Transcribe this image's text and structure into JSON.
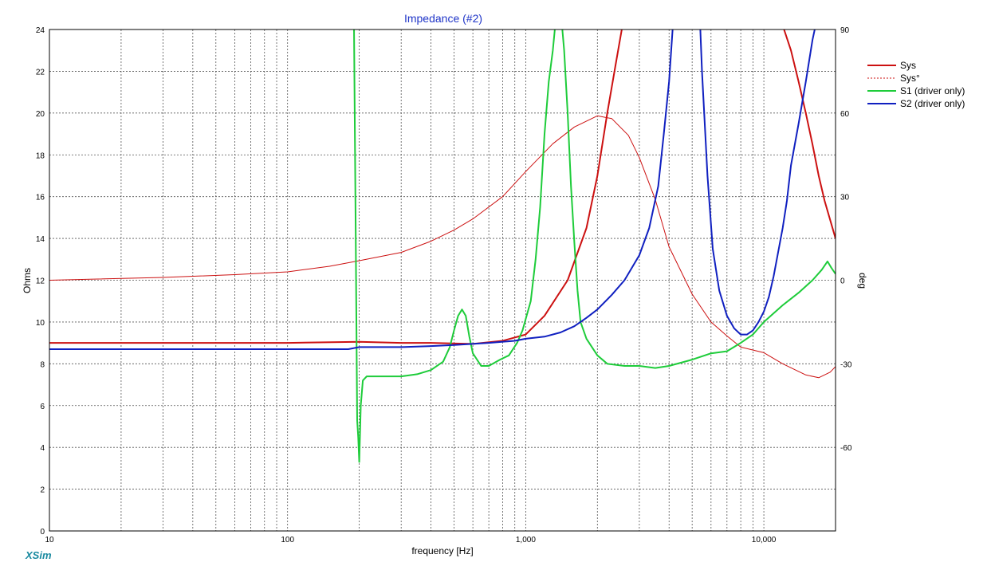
{
  "app": {
    "brand": "XSim"
  },
  "colors": {
    "sys": "#cc1111",
    "sys_phase": "#cc1111",
    "s1": "#1ecc3a",
    "s2": "#1020c0",
    "title": "#1f35c8",
    "brand": "#1a8aa0"
  },
  "chart_data": {
    "type": "line",
    "title": "Impedance (#2)",
    "xlabel": "frequency [Hz]",
    "ylabel": "Ohms",
    "y2label": "deg",
    "xscale": "log",
    "xlim": [
      10,
      20000
    ],
    "ylim": [
      0,
      24
    ],
    "y2lim": [
      -90,
      90
    ],
    "grid": true,
    "legend_position": "right",
    "x_tick_labels": [
      {
        "value": 10,
        "label": "10"
      },
      {
        "value": 100,
        "label": "100"
      },
      {
        "value": 1000,
        "label": "1,000"
      },
      {
        "value": 10000,
        "label": "10,000"
      }
    ],
    "y_ticks": [
      "0",
      "2",
      "4",
      "6",
      "8",
      "10",
      "12",
      "14",
      "16",
      "18",
      "20",
      "22",
      "24"
    ],
    "y2_ticks": [
      "90",
      "60",
      "30",
      "0",
      "-30",
      "-60"
    ],
    "series": [
      {
        "name": "Sys",
        "axis": "left",
        "style": "solid",
        "width": 2,
        "points": [
          [
            10,
            9.0
          ],
          [
            100,
            9.0
          ],
          [
            200,
            9.05
          ],
          [
            300,
            9.0
          ],
          [
            400,
            9.0
          ],
          [
            600,
            8.95
          ],
          [
            800,
            9.1
          ],
          [
            1000,
            9.4
          ],
          [
            1200,
            10.3
          ],
          [
            1500,
            12.0
          ],
          [
            1800,
            14.5
          ],
          [
            2000,
            17.0
          ],
          [
            2200,
            20.0
          ],
          [
            2400,
            22.5
          ],
          [
            2550,
            24.2
          ]
        ]
      },
      {
        "name": "Sys",
        "axis": "left",
        "style": "solid",
        "width": 2,
        "legend": false,
        "points": [
          [
            12000,
            24.2
          ],
          [
            13000,
            23.0
          ],
          [
            14000,
            21.5
          ],
          [
            15000,
            20.0
          ],
          [
            16000,
            18.5
          ],
          [
            17000,
            17.0
          ],
          [
            18000,
            15.8
          ],
          [
            20000,
            14.0
          ]
        ]
      },
      {
        "name": "Sys°",
        "axis": "right",
        "style": "thin",
        "width": 1,
        "points": [
          [
            10,
            0
          ],
          [
            30,
            1
          ],
          [
            60,
            2
          ],
          [
            100,
            3
          ],
          [
            150,
            5
          ],
          [
            200,
            7
          ],
          [
            300,
            10
          ],
          [
            400,
            14
          ],
          [
            500,
            18
          ],
          [
            600,
            22
          ],
          [
            800,
            30
          ],
          [
            1000,
            39
          ],
          [
            1300,
            49
          ],
          [
            1600,
            55
          ],
          [
            2000,
            59
          ],
          [
            2300,
            58
          ],
          [
            2700,
            52
          ],
          [
            3000,
            44
          ],
          [
            3500,
            29
          ],
          [
            4000,
            12
          ],
          [
            5000,
            -5
          ],
          [
            6000,
            -15
          ],
          [
            7000,
            -20
          ],
          [
            8000,
            -24
          ],
          [
            10000,
            -26
          ],
          [
            12000,
            -30
          ],
          [
            15000,
            -34
          ],
          [
            17000,
            -35
          ],
          [
            19000,
            -33
          ],
          [
            20000,
            -31
          ]
        ]
      },
      {
        "name": "S1 (driver only)",
        "axis": "left",
        "style": "solid",
        "width": 2,
        "points": [
          [
            190,
            24.2
          ],
          [
            193,
            15
          ],
          [
            196,
            5.3
          ],
          [
            198,
            4.5
          ],
          [
            200,
            3.3
          ],
          [
            203,
            6
          ],
          [
            207,
            7.2
          ],
          [
            215,
            7.4
          ],
          [
            260,
            7.4
          ],
          [
            300,
            7.4
          ],
          [
            350,
            7.5
          ],
          [
            400,
            7.7
          ],
          [
            450,
            8.1
          ],
          [
            480,
            8.8
          ],
          [
            500,
            9.6
          ],
          [
            520,
            10.3
          ],
          [
            540,
            10.6
          ],
          [
            560,
            10.3
          ],
          [
            580,
            9.3
          ],
          [
            600,
            8.5
          ],
          [
            650,
            7.9
          ],
          [
            700,
            7.9
          ],
          [
            780,
            8.2
          ],
          [
            850,
            8.4
          ],
          [
            920,
            9.0
          ],
          [
            970,
            9.6
          ],
          [
            1050,
            11.0
          ],
          [
            1100,
            13.0
          ],
          [
            1150,
            15.5
          ],
          [
            1200,
            19.0
          ],
          [
            1250,
            21.5
          ],
          [
            1300,
            23.0
          ],
          [
            1330,
            24.2
          ],
          [
            1420,
            24.2
          ],
          [
            1450,
            23.0
          ],
          [
            1500,
            20.0
          ],
          [
            1550,
            16.5
          ],
          [
            1600,
            13.8
          ],
          [
            1650,
            11.5
          ],
          [
            1700,
            10.0
          ],
          [
            1800,
            9.2
          ],
          [
            2000,
            8.4
          ],
          [
            2200,
            8.0
          ],
          [
            2600,
            7.9
          ],
          [
            3000,
            7.9
          ],
          [
            3500,
            7.8
          ],
          [
            4000,
            7.9
          ],
          [
            5000,
            8.2
          ],
          [
            6000,
            8.5
          ],
          [
            7000,
            8.6
          ],
          [
            8000,
            9.0
          ],
          [
            9000,
            9.4
          ],
          [
            10000,
            10.0
          ],
          [
            12000,
            10.8
          ],
          [
            14000,
            11.4
          ],
          [
            16000,
            12.0
          ],
          [
            17500,
            12.5
          ],
          [
            18500,
            12.9
          ],
          [
            19200,
            12.6
          ],
          [
            20000,
            12.3
          ]
        ]
      },
      {
        "name": "S2 (driver only)",
        "axis": "left",
        "style": "solid",
        "width": 2,
        "points": [
          [
            10,
            8.7
          ],
          [
            100,
            8.7
          ],
          [
            180,
            8.7
          ],
          [
            200,
            8.8
          ],
          [
            300,
            8.8
          ],
          [
            400,
            8.85
          ],
          [
            500,
            8.9
          ],
          [
            700,
            9.0
          ],
          [
            900,
            9.1
          ],
          [
            1000,
            9.2
          ],
          [
            1200,
            9.3
          ],
          [
            1400,
            9.5
          ],
          [
            1600,
            9.8
          ],
          [
            1800,
            10.2
          ],
          [
            2000,
            10.6
          ],
          [
            2300,
            11.3
          ],
          [
            2600,
            12.0
          ],
          [
            3000,
            13.2
          ],
          [
            3300,
            14.5
          ],
          [
            3600,
            16.5
          ],
          [
            3800,
            19.0
          ],
          [
            4000,
            21.5
          ],
          [
            4150,
            24.2
          ]
        ]
      },
      {
        "name": "S2 (driver only)",
        "axis": "left",
        "style": "solid",
        "width": 2,
        "legend": false,
        "points": [
          [
            5400,
            24.2
          ],
          [
            5500,
            22.0
          ],
          [
            5800,
            17.0
          ],
          [
            6100,
            13.5
          ],
          [
            6500,
            11.5
          ],
          [
            7000,
            10.3
          ],
          [
            7500,
            9.7
          ],
          [
            8000,
            9.4
          ],
          [
            8500,
            9.4
          ],
          [
            9000,
            9.6
          ],
          [
            9500,
            10.0
          ],
          [
            10000,
            10.5
          ],
          [
            10500,
            11.2
          ],
          [
            11000,
            12.2
          ],
          [
            12000,
            14.5
          ],
          [
            12500,
            15.8
          ],
          [
            13000,
            17.5
          ],
          [
            14000,
            19.5
          ],
          [
            15000,
            21.5
          ],
          [
            16000,
            23.5
          ],
          [
            16500,
            24.2
          ]
        ]
      }
    ]
  }
}
